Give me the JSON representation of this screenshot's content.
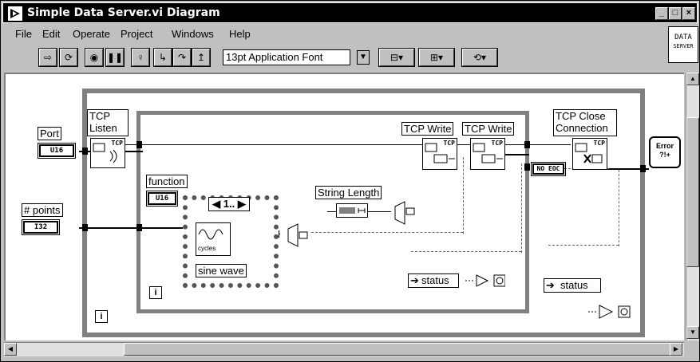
{
  "window": {
    "title": "Simple Data Server.vi Diagram",
    "minimize_glyph": "_",
    "maximize_glyph": "□",
    "close_glyph": "×"
  },
  "menu": {
    "items": [
      {
        "label": "File"
      },
      {
        "label": "Edit"
      },
      {
        "label": "Operate"
      },
      {
        "label": "Project"
      },
      {
        "label": "Windows"
      },
      {
        "label": "Help"
      }
    ]
  },
  "badge": {
    "line1": "DATA",
    "line2": "SERVER"
  },
  "toolbar": {
    "font": "13pt Application Font",
    "icons": [
      "run-arrow-icon",
      "run-continuous-icon",
      "abort-icon",
      "pause-icon",
      "highlight-execution-icon",
      "step-into-icon",
      "step-over-icon",
      "step-out-icon",
      "align-icon",
      "distribute-icon",
      "reorder-icon"
    ]
  },
  "diagram": {
    "port_label": "Port",
    "port_type": "U16",
    "points_label": "# points",
    "points_type": "I32",
    "function_label": "function",
    "function_type": "U16",
    "tcp_listen_label": "TCP\nListen",
    "tcp_write1_label": "TCP Write",
    "tcp_write2_label": "TCP Write",
    "tcp_close_label": "TCP Close\nConnection",
    "string_length_label": "String Length",
    "case_selector": "1..",
    "sine_wave_label": "sine wave",
    "cycles_label": "cycles",
    "status_label_inner": "status",
    "status_label_outer": "status",
    "no_eoc_label": "NO EOC",
    "iteration_glyph": "i",
    "tcp_tag": "TCP",
    "error_text": "Error\n?!+"
  },
  "colors": {
    "wire": "#000000",
    "loop_border": "#808080",
    "canvas": "#ffffff",
    "window_bg": "#c0c0c0"
  }
}
